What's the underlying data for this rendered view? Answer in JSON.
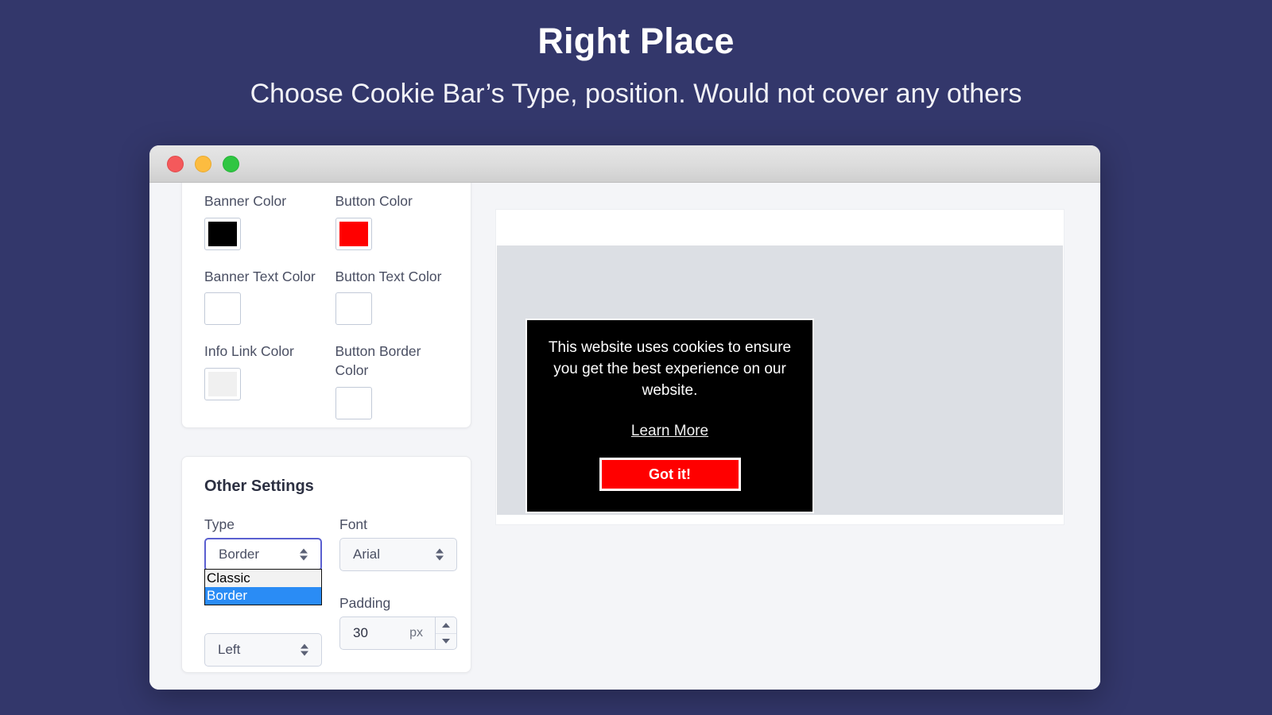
{
  "header": {
    "title": "Right Place",
    "subtitle": "Choose Cookie Bar’s Type, position. Would not cover any others"
  },
  "window": {
    "traffic_lights": [
      {
        "name": "close",
        "color": "#f4595b"
      },
      {
        "name": "minimize",
        "color": "#fcbc40"
      },
      {
        "name": "maximize",
        "color": "#2fc642"
      }
    ]
  },
  "colors_card": {
    "fields": [
      {
        "label": "Banner Color",
        "value": "#000000"
      },
      {
        "label": "Button Color",
        "value": "#ff0000"
      },
      {
        "label": "Banner Text Color",
        "value": "#ffffff"
      },
      {
        "label": "Button Text Color",
        "value": "#ffffff"
      },
      {
        "label": "Info Link Color",
        "value": "#f0f0f0"
      },
      {
        "label": "Button Border Color",
        "value": "#ffffff"
      }
    ]
  },
  "other_settings": {
    "heading": "Other Settings",
    "type": {
      "label": "Type",
      "value": "Border",
      "open": true,
      "options": [
        "Classic",
        "Border"
      ],
      "selected_option": "Border"
    },
    "font": {
      "label": "Font",
      "value": "Arial"
    },
    "position": {
      "value": "Left"
    },
    "padding": {
      "label": "Padding",
      "value": "30",
      "unit": "px"
    }
  },
  "preview": {
    "cookie_banner": {
      "text": "This website uses cookies to ensure you get the best experience on our website.",
      "link_label": "Learn More",
      "button_label": "Got it!",
      "background": "#000000",
      "button_background": "#ff0000",
      "text_color": "#ffffff"
    }
  }
}
